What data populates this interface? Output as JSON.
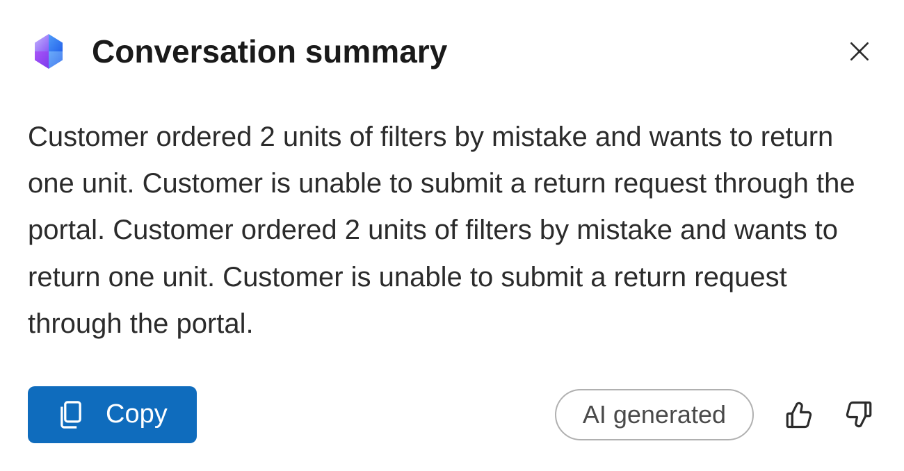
{
  "header": {
    "title": "Conversation summary"
  },
  "summary": {
    "text": "Customer ordered 2 units of filters by mistake and wants to return one unit. Customer is unable to submit a return request through the portal. Customer ordered 2 units of filters by mistake and wants to return one unit. Customer is unable to submit a return request through the portal."
  },
  "footer": {
    "copy_label": "Copy",
    "ai_badge": "AI generated"
  }
}
